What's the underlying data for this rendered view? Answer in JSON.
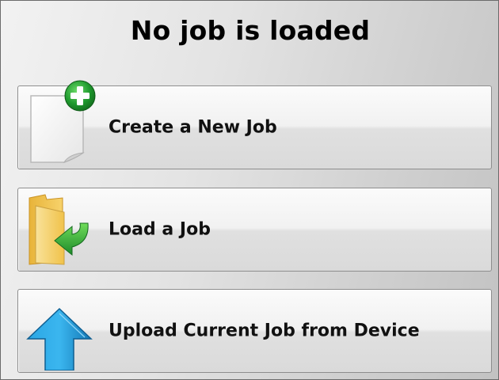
{
  "header": {
    "title": "No job is loaded"
  },
  "actions": {
    "create_new_job": {
      "label": "Create a New Job",
      "icon": "new-document-plus-icon"
    },
    "load_job": {
      "label": "Load a Job",
      "icon": "folder-load-arrow-icon"
    },
    "upload_job": {
      "label": "Upload Current Job from Device",
      "icon": "upload-arrow-icon"
    }
  },
  "colors": {
    "plus_badge": "#1f9a2e",
    "load_arrow": "#2aa83a",
    "folder": "#f2c24a",
    "upload_arrow": "#1a8fd0"
  }
}
